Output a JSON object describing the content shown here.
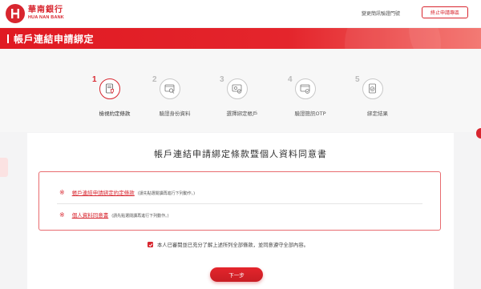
{
  "header": {
    "logo_cn": "華南銀行",
    "logo_en": "HUA NAN BANK",
    "link_change_device": "變更簡訊驗證門號",
    "btn_stop": "終止申請專區"
  },
  "banner": {
    "title": "帳戶連結申請綁定"
  },
  "steps": [
    {
      "num": "1",
      "label": "檢視約定條款",
      "icon": "document-shield-icon",
      "active": true
    },
    {
      "num": "2",
      "label": "驗證身份資料",
      "icon": "id-search-icon",
      "active": false
    },
    {
      "num": "3",
      "label": "選擇綁定帳戶",
      "icon": "account-select-icon",
      "active": false
    },
    {
      "num": "4",
      "label": "驗證簡訊OTP",
      "icon": "otp-check-icon",
      "active": false
    },
    {
      "num": "5",
      "label": "綁定結果",
      "icon": "result-check-icon",
      "active": false
    }
  ],
  "card": {
    "title": "帳戶連結申請綁定條款暨個人資料同意書",
    "terms": [
      {
        "mark": "※",
        "link": "帳戶連結申請綁定約定條款",
        "note": "(請先點選閱讀再進行下列動作。)"
      },
      {
        "mark": "※",
        "link": "個人資料同意書",
        "note": "(請先點選閱讀再進行下列動作。)"
      }
    ],
    "agree_text": "本人已審閱並已充分了解上述所列全部條款，並同意遵守全部內容。",
    "agree_checked": true,
    "next_button": "下一步"
  },
  "colors": {
    "brand_red": "#d8262f",
    "background": "#f4f4f5"
  }
}
